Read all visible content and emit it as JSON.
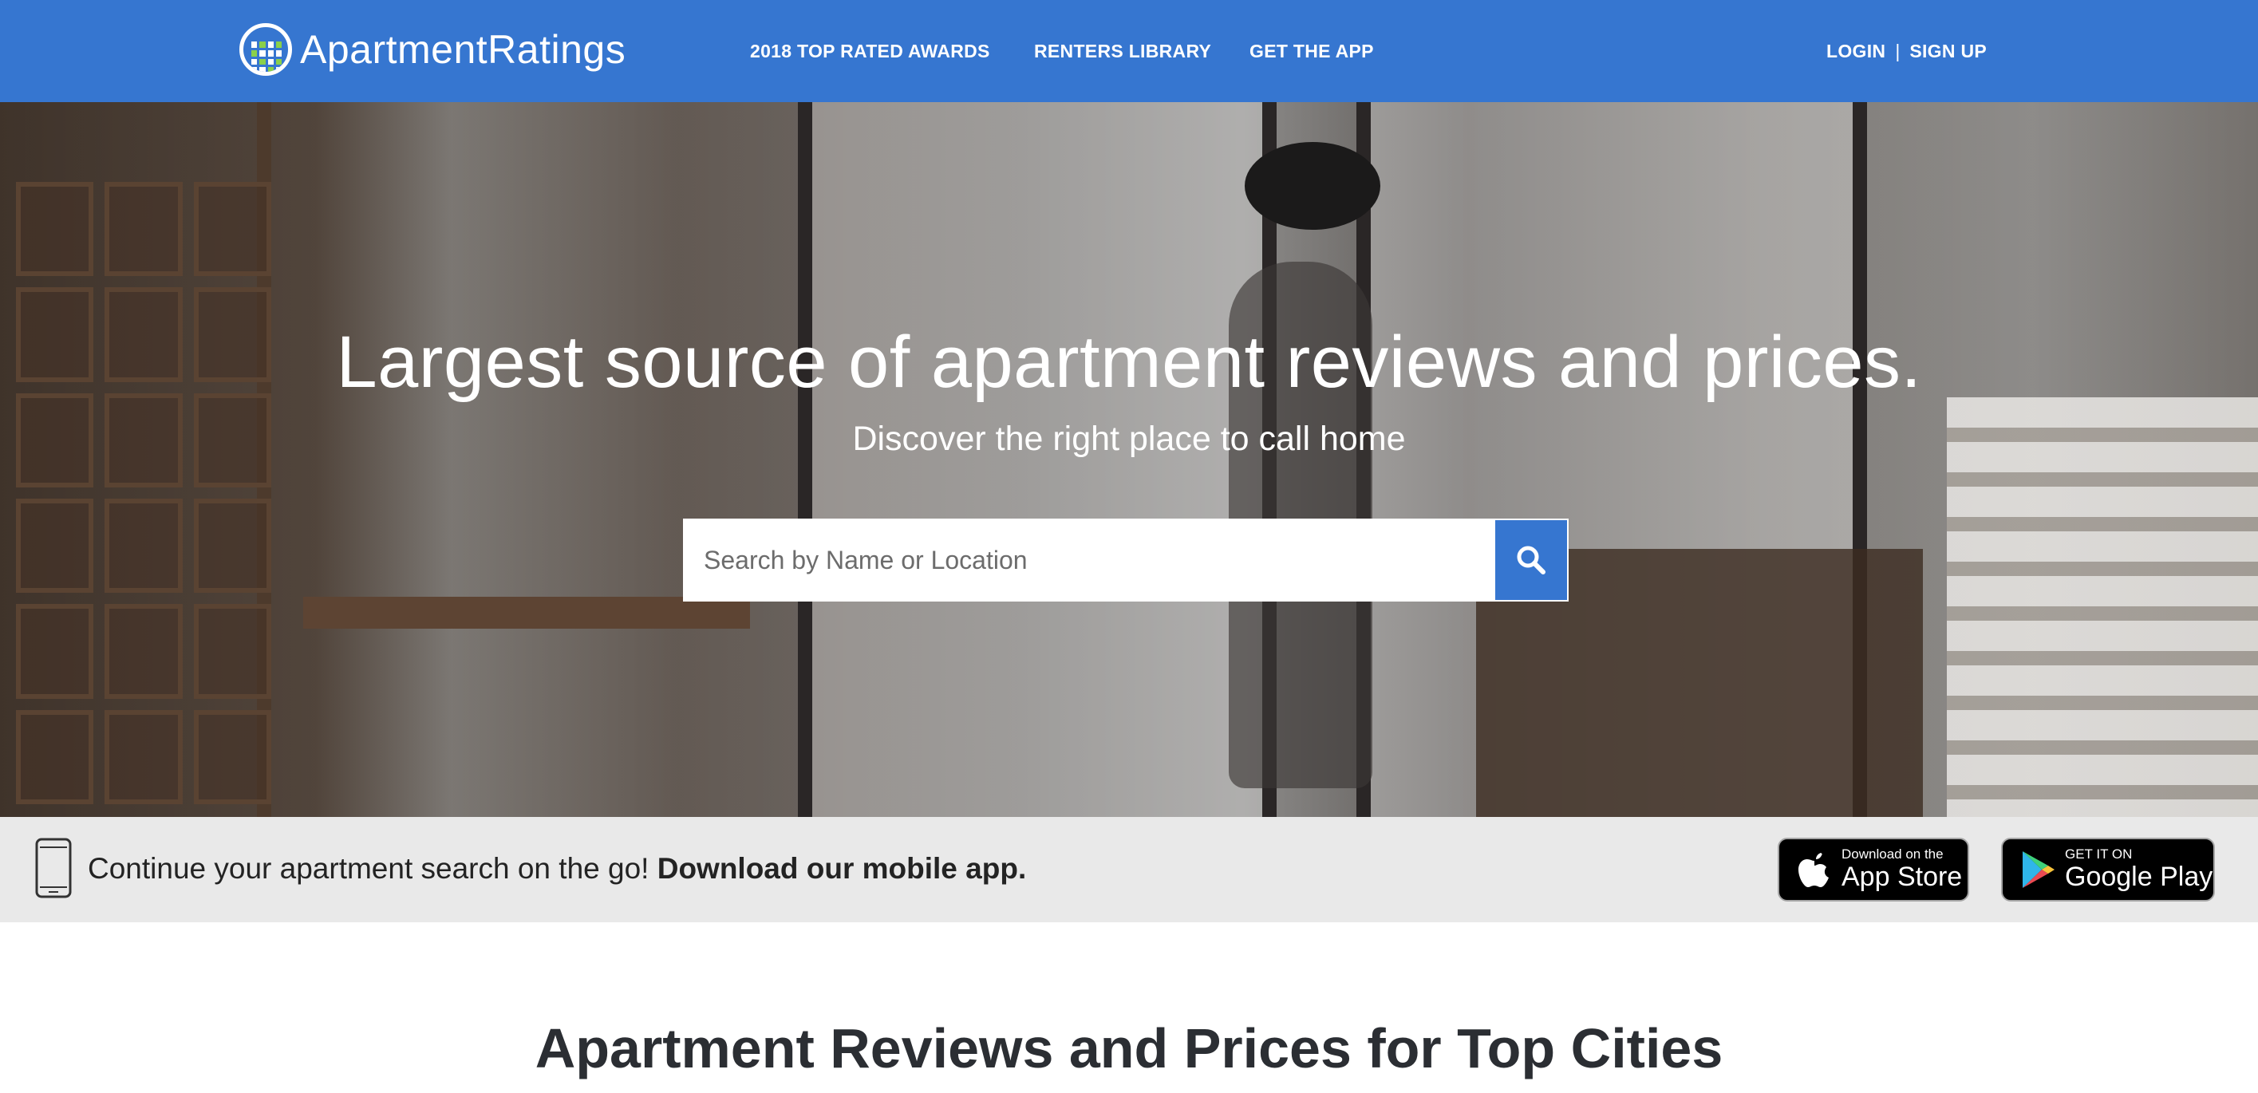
{
  "header": {
    "logo_text": "ApartmentRatings",
    "nav": {
      "awards": "2018 TOP RATED AWARDS",
      "library": "RENTERS LIBRARY",
      "app": "GET THE APP",
      "login": "LOGIN",
      "separator": "|",
      "signup": "SIGN UP"
    }
  },
  "hero": {
    "title": "Largest source of apartment reviews and prices.",
    "subtitle": "Discover the right place to call home",
    "search": {
      "placeholder": "Search by Name or Location",
      "button_icon": "search-icon"
    }
  },
  "app_bar": {
    "text_regular": "Continue your apartment search on the go!",
    "text_bold": "Download our mobile app.",
    "app_store": {
      "small": "Download on the",
      "big": "App Store",
      "icon": "apple-icon"
    },
    "google_play": {
      "small": "GET IT ON",
      "big": "Google Play",
      "icon": "google-play-icon"
    }
  },
  "section": {
    "title": "Apartment Reviews and Prices for Top Cities"
  },
  "colors": {
    "brand_blue": "#3676d0",
    "logo_green": "#8ad04a",
    "text_dark": "#2b2e33"
  }
}
